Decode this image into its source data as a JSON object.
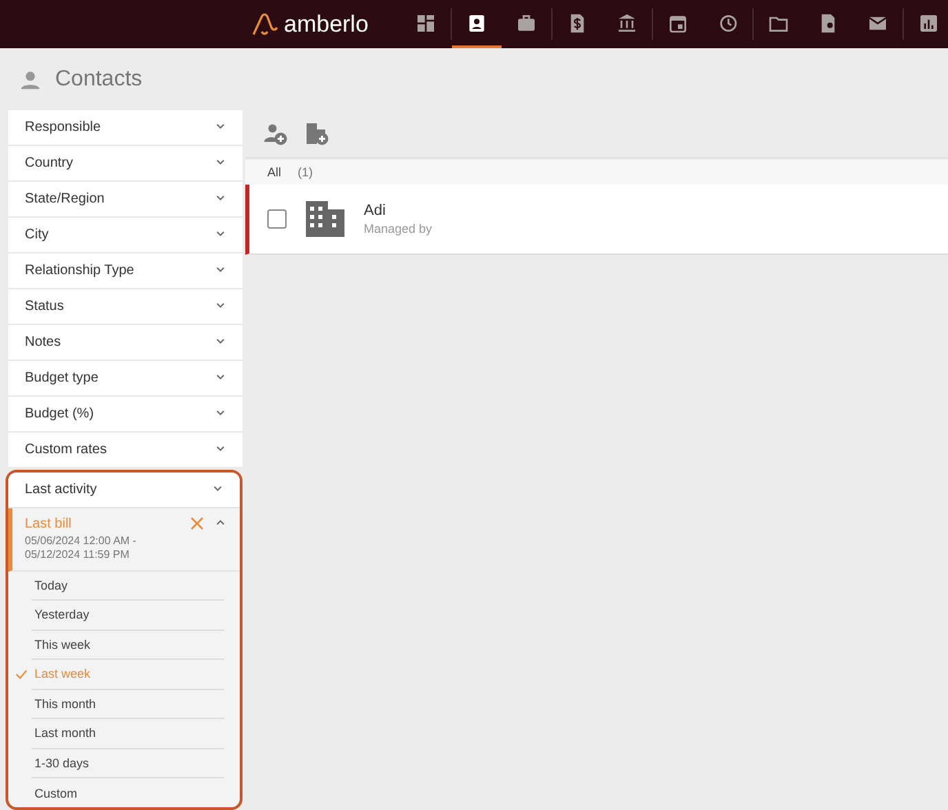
{
  "app": {
    "logo": "amberlo"
  },
  "nav_groups": [
    {
      "items": [
        {
          "kind": "dashboard",
          "selected": false
        }
      ]
    },
    {
      "items": [
        {
          "kind": "contacts",
          "selected": true
        },
        {
          "kind": "briefcase",
          "selected": false
        }
      ]
    },
    {
      "items": [
        {
          "kind": "invoice",
          "selected": false
        },
        {
          "kind": "bank",
          "selected": false
        }
      ]
    },
    {
      "items": [
        {
          "kind": "calendar",
          "selected": false
        },
        {
          "kind": "time",
          "selected": false
        }
      ]
    },
    {
      "items": [
        {
          "kind": "folder",
          "selected": false
        },
        {
          "kind": "document",
          "selected": false
        },
        {
          "kind": "mail",
          "selected": false
        }
      ]
    },
    {
      "items": [
        {
          "kind": "report",
          "selected": false
        }
      ]
    }
  ],
  "page_title": "Contacts",
  "filters": [
    {
      "label": "Responsible",
      "expanded": false
    },
    {
      "label": "Country",
      "expanded": false
    },
    {
      "label": "State/Region",
      "expanded": false
    },
    {
      "label": "City",
      "expanded": false
    },
    {
      "label": "Relationship Type",
      "expanded": false
    },
    {
      "label": "Status",
      "expanded": false
    },
    {
      "label": "Notes",
      "expanded": false
    },
    {
      "label": "Budget type",
      "expanded": false
    },
    {
      "label": "Budget (%)",
      "expanded": false
    },
    {
      "label": "Custom rates",
      "expanded": false
    }
  ],
  "last_activity": {
    "label": "Last activity",
    "expanded": false
  },
  "subfilter": {
    "label": "Last bill",
    "value": "05/06/2024 12:00 AM - 05/12/2024 11:59 PM",
    "expanded": true,
    "options": [
      {
        "label": "Today",
        "selected": false
      },
      {
        "label": "Yesterday",
        "selected": false
      },
      {
        "label": "This week",
        "selected": false
      },
      {
        "label": "Last week",
        "selected": true
      },
      {
        "label": "This month",
        "selected": false
      },
      {
        "label": "Last month",
        "selected": false
      },
      {
        "label": "1-30 days",
        "selected": false
      },
      {
        "label": "Custom",
        "selected": false
      }
    ]
  },
  "list": {
    "tab": "All",
    "count": "(1)",
    "contacts": [
      {
        "name": "Adi",
        "subtitle": "Managed by",
        "checked": false,
        "kind": "company"
      }
    ]
  }
}
